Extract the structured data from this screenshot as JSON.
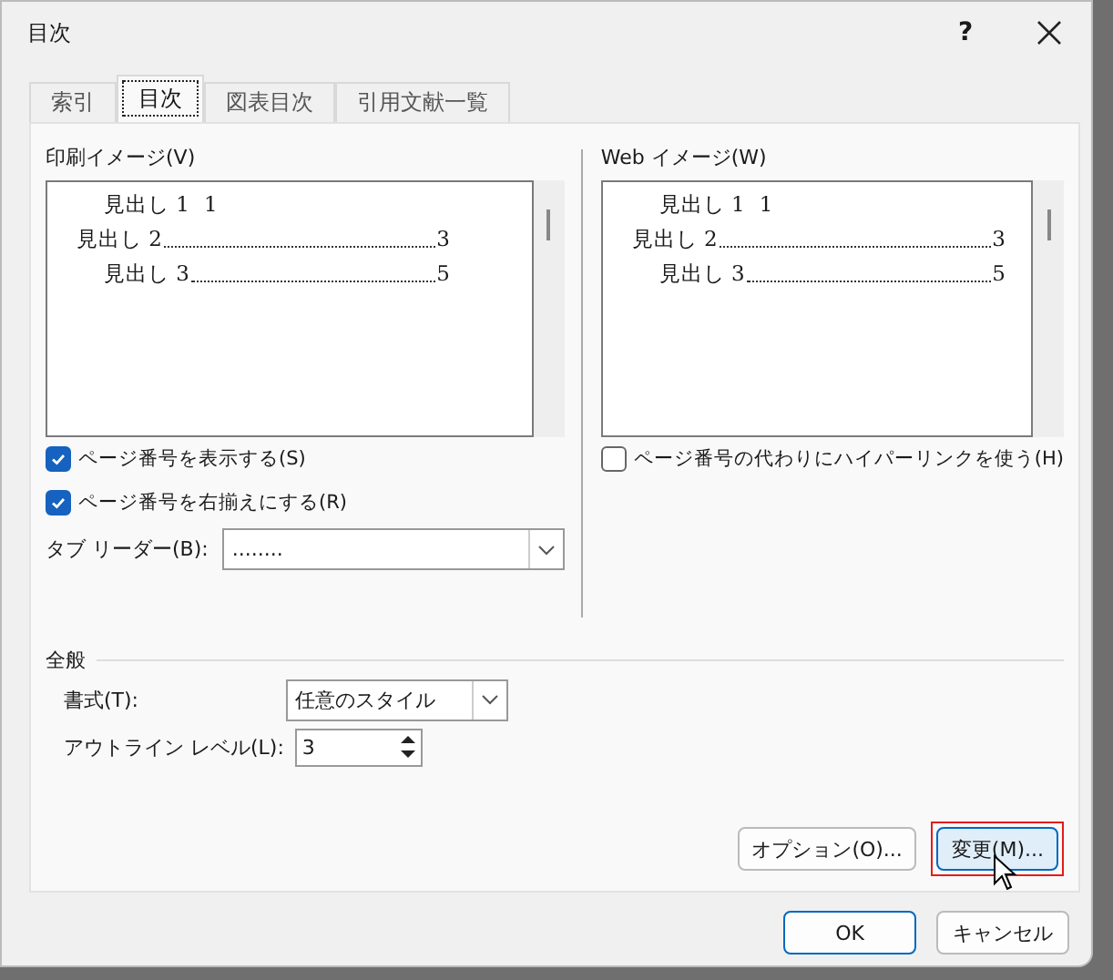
{
  "window": {
    "title": "目次",
    "help": "?"
  },
  "tabs": [
    {
      "label": "索引",
      "selected": false
    },
    {
      "label": "目次",
      "selected": true
    },
    {
      "label": "図表目次",
      "selected": false
    },
    {
      "label": "引用文献一覧",
      "selected": false
    }
  ],
  "print_preview": {
    "label": "印刷イメージ(V)",
    "lines": [
      {
        "text": "見出し 1",
        "page": "1",
        "indented": true,
        "leader": false
      },
      {
        "text": "見出し 2",
        "page": "3",
        "indented": false,
        "leader": true
      },
      {
        "text": "見出し 3",
        "page": "5",
        "indented": true,
        "leader": true
      }
    ]
  },
  "web_preview": {
    "label": "Web イメージ(W)",
    "lines": [
      {
        "text": "見出し 1",
        "page": "1",
        "indented": true,
        "leader": false
      },
      {
        "text": "見出し 2",
        "page": "3",
        "indented": false,
        "leader": true
      },
      {
        "text": "見出し 3",
        "page": "5",
        "indented": true,
        "leader": true
      }
    ]
  },
  "print_options": [
    {
      "label": "ページ番号を表示する(S)",
      "checked": true
    },
    {
      "label": "ページ番号を右揃えにする(R)",
      "checked": true
    }
  ],
  "tab_leader": {
    "label": "タブ リーダー(B):",
    "value": "........"
  },
  "web_options": [
    {
      "label": "ページ番号の代わりにハイパーリンクを使う(H)",
      "checked": false
    }
  ],
  "general": {
    "title": "全般",
    "format": {
      "label": "書式(T):",
      "value": "任意のスタイル"
    },
    "outline_level": {
      "label": "アウトライン レベル(L):",
      "value": "3"
    }
  },
  "panel_buttons": [
    {
      "label": "オプション(O)...",
      "highlighted": false
    },
    {
      "label": "変更(M)...",
      "highlighted": true
    }
  ],
  "buttons": [
    {
      "label": "OK",
      "default": true
    },
    {
      "label": "キャンセル",
      "default": false
    }
  ]
}
